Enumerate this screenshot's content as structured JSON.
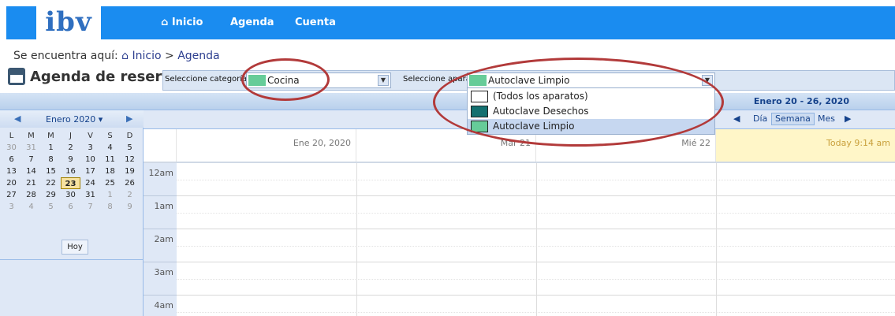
{
  "nav": {
    "logo": "ibv",
    "items": [
      "Inicio",
      "Agenda",
      "Cuenta"
    ]
  },
  "breadcrumb": {
    "prefix": "Se encuentra aquí:",
    "home": "Inicio",
    "sep": ">",
    "current": "Agenda"
  },
  "title": "Agenda de reservas",
  "filters": {
    "category_label": "Seleccione categoría",
    "category_value": "Cocina",
    "category_color": "#66cc99",
    "device_label": "Seleccione aparato:",
    "device_value": "Autoclave Limpio",
    "device_color": "#66cc99"
  },
  "dropdown": {
    "options": [
      {
        "label": "(Todos los aparatos)",
        "color": "#ffffff"
      },
      {
        "label": "Autoclave Desechos",
        "color": "#137070"
      },
      {
        "label": "Autoclave Limpio",
        "color": "#66cc99",
        "selected": true
      }
    ]
  },
  "range": "Enero 20 - 26, 2020",
  "mini": {
    "month": "Enero 2020",
    "dow": [
      "L",
      "M",
      "M",
      "J",
      "V",
      "S",
      "D"
    ],
    "weeks": [
      [
        "30",
        "31",
        "1",
        "2",
        "3",
        "4",
        "5"
      ],
      [
        "6",
        "7",
        "8",
        "9",
        "10",
        "11",
        "12"
      ],
      [
        "13",
        "14",
        "15",
        "16",
        "17",
        "18",
        "19"
      ],
      [
        "20",
        "21",
        "22",
        "23",
        "24",
        "25",
        "26"
      ],
      [
        "27",
        "28",
        "29",
        "30",
        "31",
        "1",
        "2"
      ],
      [
        "3",
        "4",
        "5",
        "6",
        "7",
        "8",
        "9"
      ]
    ],
    "today_label": "Hoy"
  },
  "views": {
    "day": "Día",
    "week": "Semana",
    "month": "Mes"
  },
  "days": [
    "Ene 20, 2020",
    "Mar 21",
    "Mié 22",
    "Today 9:14 am"
  ],
  "hours": [
    "12am",
    "1am",
    "2am",
    "3am",
    "4am"
  ]
}
